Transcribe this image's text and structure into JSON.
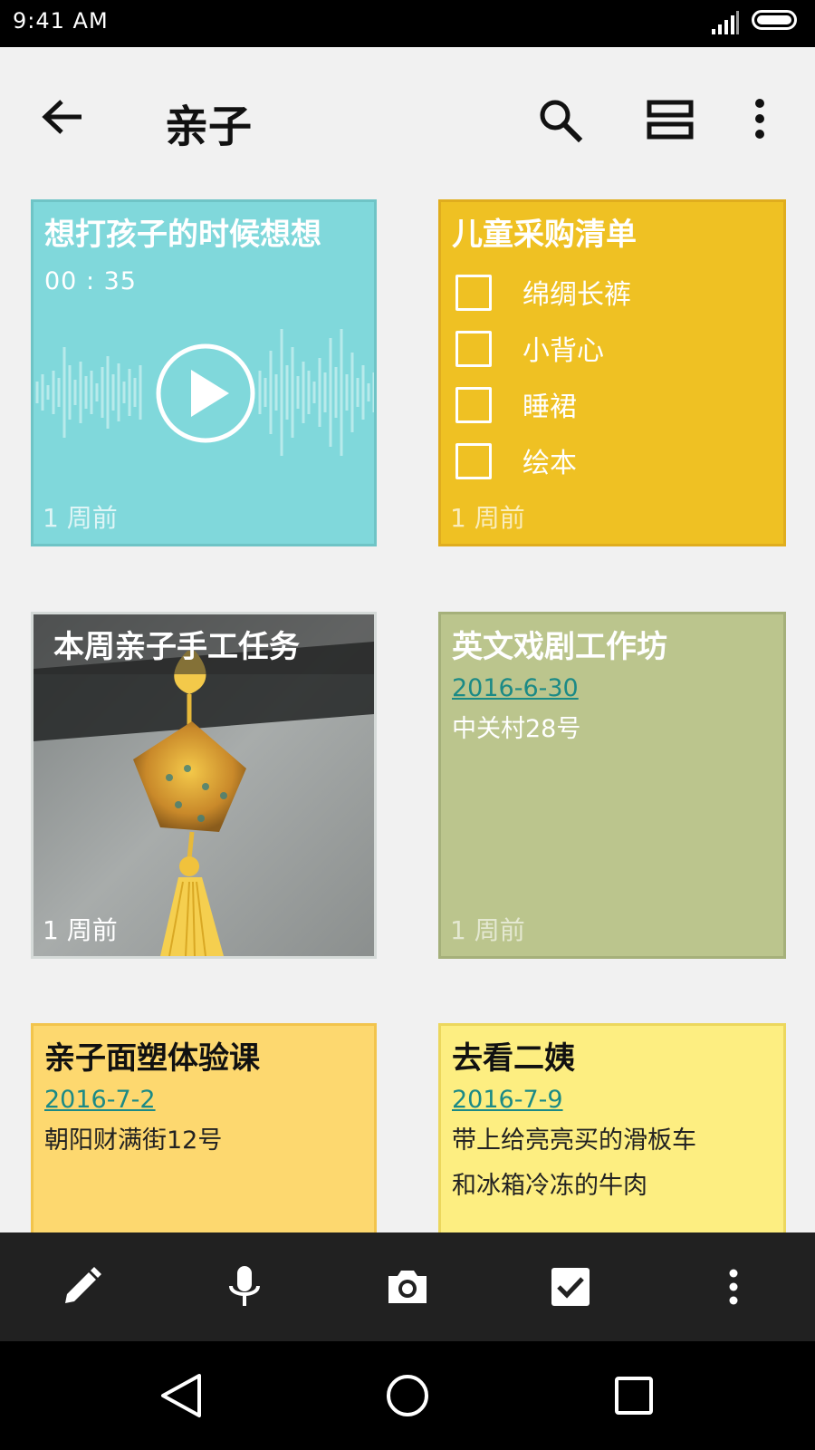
{
  "status_bar": {
    "time": "9:41 AM",
    "icons": [
      "signal-icon",
      "battery-icon"
    ]
  },
  "toolbar": {
    "title": "亲子",
    "icons": [
      "back-arrow-icon",
      "search-icon",
      "view-toggle-icon",
      "more-vert-icon"
    ]
  },
  "notes": [
    {
      "type": "audio",
      "title": "想打孩子的时候想想",
      "duration": "00 : 35",
      "time": "1 周前",
      "color": "#80d8db",
      "icons": [
        "play-icon",
        "waveform"
      ]
    },
    {
      "type": "checklist",
      "title": "儿童采购清单",
      "items": [
        {
          "label": "绵绸长裤",
          "checked": false
        },
        {
          "label": "小背心",
          "checked": false
        },
        {
          "label": "睡裙",
          "checked": false
        },
        {
          "label": "绘本",
          "checked": false
        }
      ],
      "time": "1 周前",
      "color": "#efc123"
    },
    {
      "type": "image",
      "title": "本周亲子手工任务",
      "time": "1 周前",
      "image_alt": "yellow chinese knot sachet ornament with tassel"
    },
    {
      "type": "event",
      "title": "英文戏剧工作坊",
      "date": "2016-6-30",
      "location": "中关村28号",
      "time": "1 周前",
      "color": "#bbc58d"
    },
    {
      "type": "event",
      "title": "亲子面塑体验课",
      "date": "2016-7-2",
      "location": "朝阳财满街12号",
      "color": "#fdd86f"
    },
    {
      "type": "event",
      "title": "去看二姨",
      "date": "2016-7-9",
      "lines": [
        "带上给亮亮买的滑板车",
        "和冰箱冷冻的牛肉"
      ],
      "color": "#fdee81"
    }
  ],
  "bottom_bar": {
    "icons": [
      "pencil-icon",
      "microphone-icon",
      "camera-icon",
      "checkbox-icon",
      "more-vert-icon"
    ]
  },
  "nav_bar": {
    "icons": [
      "nav-back-icon",
      "nav-home-icon",
      "nav-recents-icon"
    ]
  }
}
